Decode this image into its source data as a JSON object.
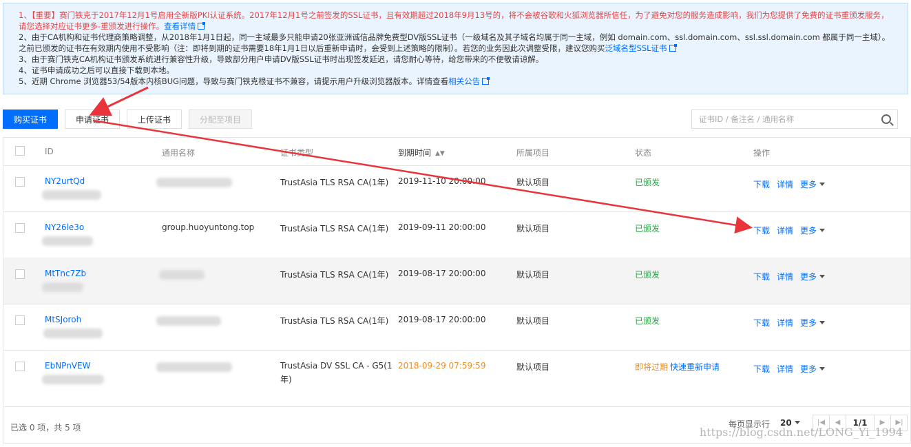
{
  "notice": {
    "line1_prefix": "1、【重要】赛门铁克于2017年12月1号启用全新版PKI认证系统。2017年12月1号之前签发的SSL证书，且有效期超过2018年9月13号的，将不会被谷歌和火狐浏览器所信任，为了避免对您的服务造成影响，我们为您提供了免费的证书重颁发服务，请您选择对应证书更多-重颁发进行操作。",
    "line1_link": "查看详情",
    "line2_prefix": "2、由于CA机构和证书代理商策略调整，从2018年1月1日起，同一主域最多只能申请20张亚洲诚信品牌免费型DV版SSL证书（一级域名及其子域名均属于同一主域，例如 domain.com、ssl.domain.com、ssl.ssl.domain.com 都属于同一主域）。之前已颁发的证书在有效期内使用不受影响（注：即将到期的证书需要18年1月1日以后重新申请时，会受到上述策略的限制）。若您的业务因此次调整受限，建议您购买",
    "line2_link": "泛域名型SSL证书",
    "line3": "3、由于赛门铁克CA机构证书颁发系统进行兼容性升级，导致部分用户申请DV版SSL证书时出现签发延迟，请您耐心等待，给您带来的不便敬请谅解。",
    "line4": "4、证书申请成功之后可以直接下载到本地。",
    "line5_prefix": "5、近期 Chrome 浏览器53/54版本内核BUG问题，导致与赛门铁克根证书不兼容，请提示用户升级浏览器版本。详情查看",
    "line5_link": "相关公告"
  },
  "toolbar": {
    "buy_label": "购买证书",
    "apply_label": "申请证书",
    "upload_label": "上传证书",
    "assign_label": "分配至项目",
    "search_placeholder": "证书ID / 备注名 / 通用名称"
  },
  "table": {
    "headers": {
      "id": "ID",
      "common_name": "通用名称",
      "cert_type": "证书类型",
      "expiry": "到期时间",
      "project": "所属项目",
      "status": "状态",
      "actions": "操作"
    },
    "rows": [
      {
        "id": "NY2urtQd",
        "common_name": "",
        "cert_type": "TrustAsia TLS RSA CA(1年)",
        "expiry": "2019-11-10 20:00:00",
        "project": "默认项目",
        "status": "已颁发"
      },
      {
        "id": "NY26le3o",
        "common_name": "group.huoyuntong.top",
        "cert_type": "TrustAsia TLS RSA CA(1年)",
        "expiry": "2019-09-11 20:00:00",
        "project": "默认项目",
        "status": "已颁发"
      },
      {
        "id": "MtTnc7Zb",
        "common_name": "",
        "cert_type": "TrustAsia TLS RSA CA(1年)",
        "expiry": "2019-08-17 20:00:00",
        "project": "默认项目",
        "status": "已颁发"
      },
      {
        "id": "MtSJoroh",
        "common_name": "",
        "cert_type": "TrustAsia TLS RSA CA(1年)",
        "expiry": "2019-08-17 20:00:00",
        "project": "默认项目",
        "status": "已颁发"
      },
      {
        "id": "EbNPnVEW",
        "common_name": "",
        "cert_type_line1": "TrustAsia DV SSL CA - G5(1",
        "cert_type_line2": "年)",
        "expiry": "2018-09-29 07:59:59",
        "project": "默认项目",
        "status": "即将过期",
        "status_action": "快速重新申请"
      }
    ],
    "actions": {
      "download": "下载",
      "detail": "详情",
      "more": "更多"
    }
  },
  "footer": {
    "summary": "已选 0 项，共 5 项",
    "per_page_label": "每页显示行",
    "per_page_value": "20",
    "page_indicator": "1/1"
  },
  "watermark": "https://blog.csdn.net/LONG_Yi_1994",
  "colors": {
    "primary": "#006eff",
    "issued": "#2ba245",
    "expiring": "#f08c1d",
    "notice_red": "#e54545",
    "arrow": "#e8343a"
  }
}
